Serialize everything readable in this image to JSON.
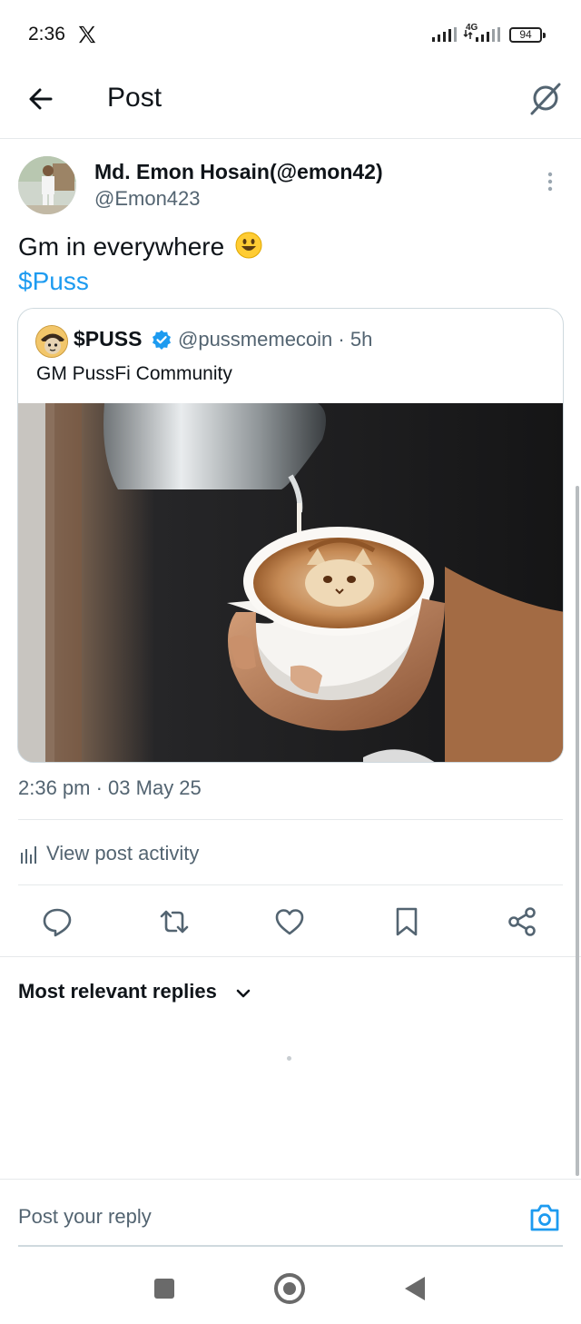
{
  "status_bar": {
    "time": "2:36",
    "network": "4G",
    "battery": "94"
  },
  "header": {
    "title": "Post"
  },
  "post": {
    "author_name": "Md. Emon Hosain(@emon42)",
    "author_handle": "@Emon423",
    "text": "Gm in everywhere",
    "cashtag": "$Puss",
    "date": "2:36 pm · 03 May 25"
  },
  "quote": {
    "name": "$PUSS",
    "handle_time": "@pussmemecoin · 5h",
    "text": "GM PussFi Community"
  },
  "activity": {
    "label": "View post activity"
  },
  "actions": {
    "icons": [
      "reply-icon",
      "repost-icon",
      "like-icon",
      "bookmark-icon",
      "share-icon"
    ]
  },
  "replies": {
    "sort_label": "Most relevant replies"
  },
  "reply_bar": {
    "placeholder": "Post your reply"
  },
  "colors": {
    "accent": "#1d9bf0",
    "secondary_text": "#536471",
    "border": "#cfd9de"
  }
}
